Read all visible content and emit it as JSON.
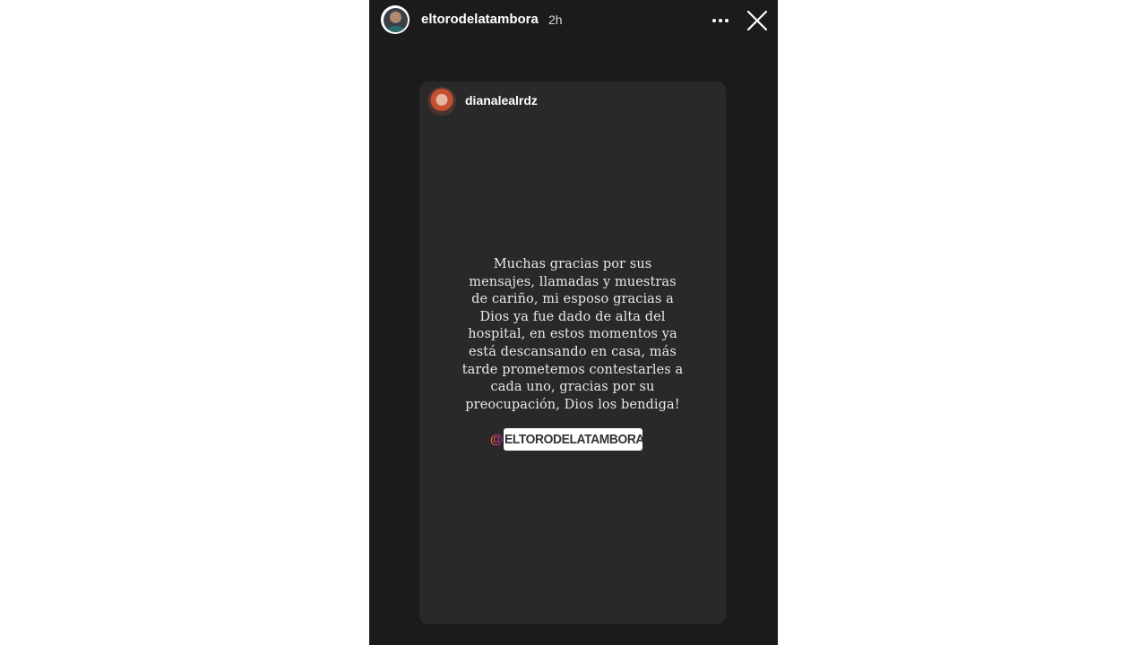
{
  "header": {
    "username": "eltorodelatambora",
    "timestamp": "2h",
    "more_icon": "more-horizontal-icon",
    "close_icon": "close-icon"
  },
  "shared_post": {
    "username": "dianalealrdz",
    "message": "Muchas gracias por sus\nmensajes, llamadas y muestras\nde cariño, mi esposo gracias a\nDios ya fue dado de alta del\nhospital, en estos momentos ya\nestá descansando en casa, más\ntarde prometemos contestarles a\ncada uno, gracias por su\npreocupación, Dios los bendiga!",
    "mention_at": "@",
    "mention_name": "ELTORODELATAMBORA"
  },
  "colors": {
    "story_background": "#1b1b1b",
    "card_background": "#292929",
    "page_background": "#ffffff"
  }
}
